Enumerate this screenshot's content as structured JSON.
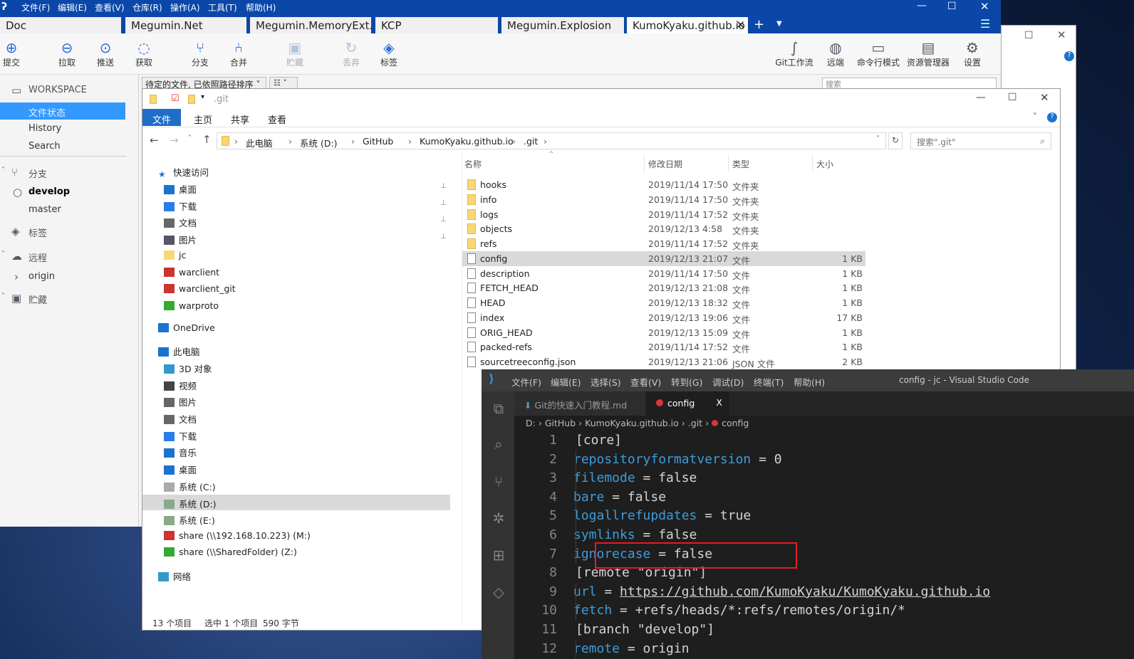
{
  "sourcetree": {
    "menu": [
      "文件(F)",
      "编辑(E)",
      "查看(V)",
      "仓库(R)",
      "操作(A)",
      "工具(T)",
      "帮助(H)"
    ],
    "tabs": [
      "Doc",
      "Megumin.Net",
      "Megumin.MemoryExt...",
      "KCP",
      "Megumin.Explosion",
      "KumoKyaku.github.io"
    ],
    "toolbar": [
      {
        "label": "提交",
        "icon": "plus-circle-icon"
      },
      {
        "label": "拉取",
        "icon": "pull-icon"
      },
      {
        "label": "推送",
        "icon": "push-icon"
      },
      {
        "label": "获取",
        "icon": "fetch-icon"
      },
      {
        "label": "分支",
        "icon": "branch-icon"
      },
      {
        "label": "合并",
        "icon": "merge-icon"
      },
      {
        "label": "贮藏",
        "icon": "stash-icon"
      },
      {
        "label": "丢弃",
        "icon": "discard-icon"
      },
      {
        "label": "标签",
        "icon": "tag-icon"
      }
    ],
    "toolbar_right": [
      {
        "label": "Git工作流",
        "icon": "git-flow-icon"
      },
      {
        "label": "远端",
        "icon": "globe-icon"
      },
      {
        "label": "命令行模式",
        "icon": "terminal-icon"
      },
      {
        "label": "资源管理器",
        "icon": "explorer-icon"
      },
      {
        "label": "设置",
        "icon": "gear-icon"
      }
    ],
    "filter_dropdown": "待定的文件, 已依照路径排序",
    "search_placeholder": "搜索",
    "sidebar": {
      "workspace": "WORKSPACE",
      "workspace_items": [
        "文件状态",
        "History",
        "Search"
      ],
      "branches": "分支",
      "branch_items": [
        "develop",
        "master"
      ],
      "tags": "标签",
      "remotes": "远程",
      "remote_items": [
        "origin"
      ],
      "stashes": "贮藏"
    },
    "accent": "#0a47a8"
  },
  "explorer": {
    "title": ".git",
    "ribbon": [
      "文件",
      "主页",
      "共享",
      "查看"
    ],
    "breadcrumb": [
      "此电脑",
      "系统 (D:)",
      "GitHub",
      "KumoKyaku.github.io",
      ".git"
    ],
    "search_placeholder": "搜索\".git\"",
    "nav": [
      {
        "label": "快速访问",
        "level": 0
      },
      {
        "label": "桌面",
        "level": 1,
        "pin": true
      },
      {
        "label": "下载",
        "level": 1,
        "pin": true
      },
      {
        "label": "文档",
        "level": 1,
        "pin": true
      },
      {
        "label": "图片",
        "level": 1,
        "pin": true
      },
      {
        "label": "jc",
        "level": 1
      },
      {
        "label": "warclient",
        "level": 1
      },
      {
        "label": "warclient_git",
        "level": 1
      },
      {
        "label": "warproto",
        "level": 1
      },
      {
        "label": "OneDrive",
        "level": 0
      },
      {
        "label": "此电脑",
        "level": 0
      },
      {
        "label": "3D 对象",
        "level": 1
      },
      {
        "label": "视频",
        "level": 1
      },
      {
        "label": "图片",
        "level": 1
      },
      {
        "label": "文档",
        "level": 1
      },
      {
        "label": "下载",
        "level": 1
      },
      {
        "label": "音乐",
        "level": 1
      },
      {
        "label": "桌面",
        "level": 1
      },
      {
        "label": "系统 (C:)",
        "level": 1
      },
      {
        "label": "系统 (D:)",
        "level": 1,
        "selected": true
      },
      {
        "label": "系统 (E:)",
        "level": 1
      },
      {
        "label": "share (\\\\192.168.10.223) (M:)",
        "level": 1
      },
      {
        "label": "share (\\\\SharedFolder) (Z:)",
        "level": 1
      },
      {
        "label": "网络",
        "level": 0
      }
    ],
    "columns": [
      "名称",
      "修改日期",
      "类型",
      "大小"
    ],
    "files": [
      {
        "name": "hooks",
        "date": "2019/11/14 17:50",
        "type": "文件夹",
        "size": "",
        "folder": true
      },
      {
        "name": "info",
        "date": "2019/11/14 17:50",
        "type": "文件夹",
        "size": "",
        "folder": true
      },
      {
        "name": "logs",
        "date": "2019/11/14 17:52",
        "type": "文件夹",
        "size": "",
        "folder": true
      },
      {
        "name": "objects",
        "date": "2019/12/13 4:58",
        "type": "文件夹",
        "size": "",
        "folder": true
      },
      {
        "name": "refs",
        "date": "2019/11/14 17:52",
        "type": "文件夹",
        "size": "",
        "folder": true
      },
      {
        "name": "config",
        "date": "2019/12/13 21:07",
        "type": "文件",
        "size": "1 KB",
        "selected": true
      },
      {
        "name": "description",
        "date": "2019/11/14 17:50",
        "type": "文件",
        "size": "1 KB"
      },
      {
        "name": "FETCH_HEAD",
        "date": "2019/12/13 21:08",
        "type": "文件",
        "size": "1 KB"
      },
      {
        "name": "HEAD",
        "date": "2019/12/13 18:32",
        "type": "文件",
        "size": "1 KB"
      },
      {
        "name": "index",
        "date": "2019/12/13 19:06",
        "type": "文件",
        "size": "17 KB"
      },
      {
        "name": "ORIG_HEAD",
        "date": "2019/12/13 15:09",
        "type": "文件",
        "size": "1 KB"
      },
      {
        "name": "packed-refs",
        "date": "2019/11/14 17:52",
        "type": "文件",
        "size": "1 KB"
      },
      {
        "name": "sourcetreeconfig.json",
        "date": "2019/12/13 21:06",
        "type": "JSON 文件",
        "size": "2 KB"
      }
    ],
    "status": {
      "count": "13 个项目",
      "selected": "选中 1 个项目",
      "size": "590 字节"
    }
  },
  "vscode": {
    "menu": [
      "文件(F)",
      "编辑(E)",
      "选择(S)",
      "查看(V)",
      "转到(G)",
      "调试(D)",
      "终端(T)",
      "帮助(H)"
    ],
    "title": "config - jc - Visual Studio Code",
    "tabs": [
      {
        "label": "Git的快速入门教程.md"
      },
      {
        "label": "config",
        "active": true,
        "close": "X"
      }
    ],
    "breadcrumb": [
      "D:",
      "GitHub",
      "KumoKyaku.github.io",
      ".git",
      "config"
    ],
    "lines": [
      {
        "n": "1",
        "k": "",
        "t": "[core]",
        "i": false
      },
      {
        "n": "2",
        "k": "repositoryformatversion",
        "t": " = 0",
        "i": true
      },
      {
        "n": "3",
        "k": "filemode",
        "t": " = false",
        "i": true
      },
      {
        "n": "4",
        "k": "bare",
        "t": " = false",
        "i": true
      },
      {
        "n": "5",
        "k": "logallrefupdates",
        "t": " = true",
        "i": true
      },
      {
        "n": "6",
        "k": "symlinks",
        "t": " = false",
        "i": true
      },
      {
        "n": "7",
        "k": "ignorecase",
        "t": " = false",
        "i": true,
        "highlight": true
      },
      {
        "n": "8",
        "k": "",
        "t": "[remote \"origin\"]",
        "i": false
      },
      {
        "n": "9",
        "k": "url",
        "t": " = ",
        "link": "https://github.com/KumoKyaku/KumoKyaku.github.io",
        "i": true
      },
      {
        "n": "10",
        "k": "fetch",
        "t": " = +refs/heads/*:refs/remotes/origin/*",
        "i": true
      },
      {
        "n": "11",
        "k": "",
        "t": "[branch \"develop\"]",
        "i": false
      },
      {
        "n": "12",
        "k": "remote",
        "t": " = origin",
        "i": true
      }
    ],
    "highlight_color": "#e51c23"
  }
}
